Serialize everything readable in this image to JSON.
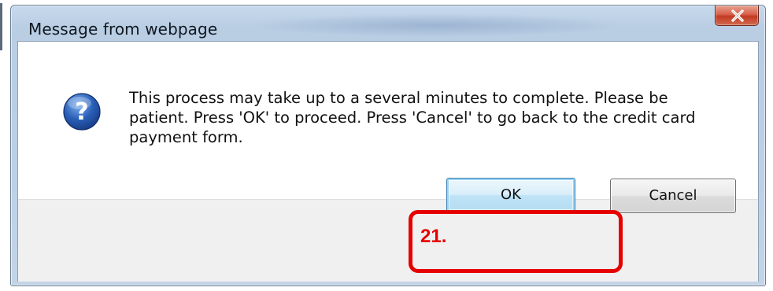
{
  "dialog": {
    "title": "Message from webpage",
    "message": "This process may take up to a several minutes to complete.  Please be patient.  Press 'OK' to proceed.  Press 'Cancel' to go back to the credit card payment form.",
    "icon": "question-icon",
    "buttons": {
      "ok_label": "OK",
      "cancel_label": "Cancel"
    }
  },
  "annotation": {
    "step_label": "21.",
    "color": "#e60000"
  },
  "colors": {
    "close_button": "#c23b22",
    "ok_focus_border": "#3c7fb1"
  }
}
